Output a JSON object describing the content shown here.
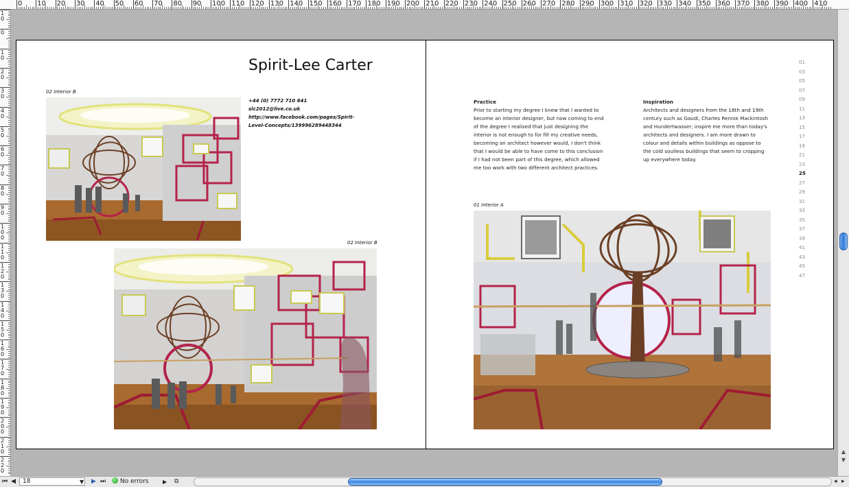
{
  "ruler": {
    "top_labels": [
      "0",
      "10",
      "20",
      "30",
      "40",
      "50",
      "60",
      "70",
      "80",
      "90",
      "100",
      "110",
      "120",
      "130",
      "140",
      "150",
      "160",
      "170",
      "180",
      "190",
      "200",
      "210",
      "220",
      "230",
      "240",
      "250",
      "260",
      "270",
      "280",
      "290",
      "300",
      "310",
      "320",
      "330",
      "340",
      "350",
      "360",
      "370",
      "380",
      "390",
      "400",
      "410"
    ],
    "left_labels": [
      "10",
      "0",
      "10",
      "20",
      "30",
      "40",
      "50",
      "60",
      "70",
      "80",
      "90",
      "100",
      "110",
      "120",
      "130",
      "140",
      "150",
      "160",
      "170",
      "180",
      "190",
      "200",
      "210",
      "220"
    ]
  },
  "left_page": {
    "title": "Spirit-Lee Carter",
    "caption_top": "02 Interior B",
    "caption_bottom": "02 Interior B",
    "contact": {
      "phone": "+44 (0) 7772 710 641",
      "email": "slc2012@live.co.uk",
      "url": "http://www.facebook.com/pages/Spirit-Level-Concepts/139996289448344"
    }
  },
  "right_page": {
    "practice": {
      "heading": "Practice",
      "body": "Prior to starting my degree I knew that I wanted to become an interior designer, but now coming to end of the degree I realised that just designing the interior is not enough to for fill my creative needs, becoming an architect however would, I don't think that I would be able to have come to this conclusion if I had not been part of this degree, which allowed me too work with two different architect practices."
    },
    "inspiration": {
      "heading": "Inspiration",
      "body": "Architects and designers from the 18th and 19th century such as Gaudi, Charles Rennie Mackintosh and Hundertwasser; inspire me more than today's architects and designers. I am more drawn to colour and details within buildings as oppose to the cold soulless buildings that seem to cropping up everywhere today."
    },
    "caption": "01 Interior A",
    "page_numbers": [
      "01",
      "03",
      "05",
      "07",
      "09",
      "11",
      "13",
      "15",
      "17",
      "19",
      "21",
      "23",
      "25",
      "27",
      "29",
      "31",
      "33",
      "35",
      "37",
      "39",
      "41",
      "43",
      "45",
      "47"
    ],
    "current_page": "25"
  },
  "statusbar": {
    "page_field": "18",
    "preflight": "No errors"
  }
}
